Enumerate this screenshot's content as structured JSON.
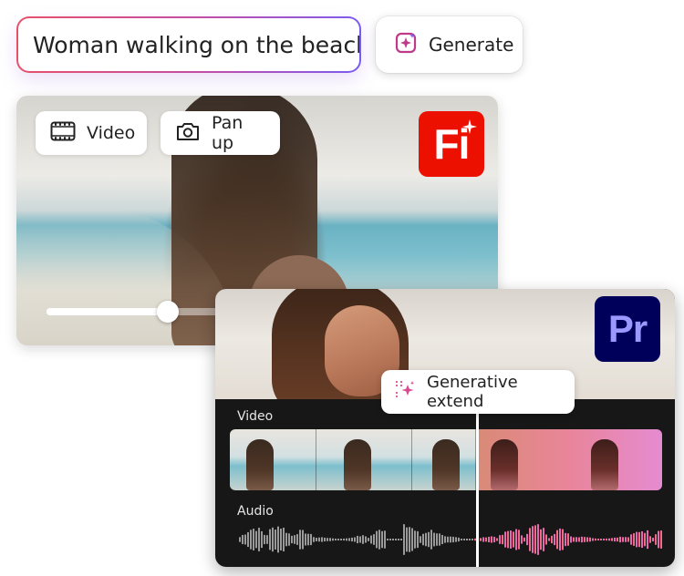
{
  "prompt": {
    "value": "Woman walking on the beach"
  },
  "generate": {
    "label": "Generate",
    "icon": "sparkle-icon"
  },
  "firefly_card": {
    "chips": [
      {
        "label": "Video",
        "icon": "film-icon"
      },
      {
        "label": "Pan up",
        "icon": "camera-icon"
      }
    ],
    "logo_text": "Fi",
    "brand_color": "#eb1000",
    "slider_level": 0.51
  },
  "premiere_card": {
    "logo_text": "Pr",
    "brand_color": "#00005b",
    "logo_text_color": "#9999ff",
    "generative_extend_label": "Generative extend",
    "tracks": {
      "video_label": "Video",
      "audio_label": "Audio"
    },
    "playhead_position": 0.57
  },
  "colors": {
    "prompt_gradient_start": "#e8506a",
    "prompt_gradient_end": "#7b5cf0",
    "waveform_original": "#9a9a9a",
    "waveform_generated_start": "#f06a6a",
    "waveform_generated_end": "#e26bd2"
  }
}
